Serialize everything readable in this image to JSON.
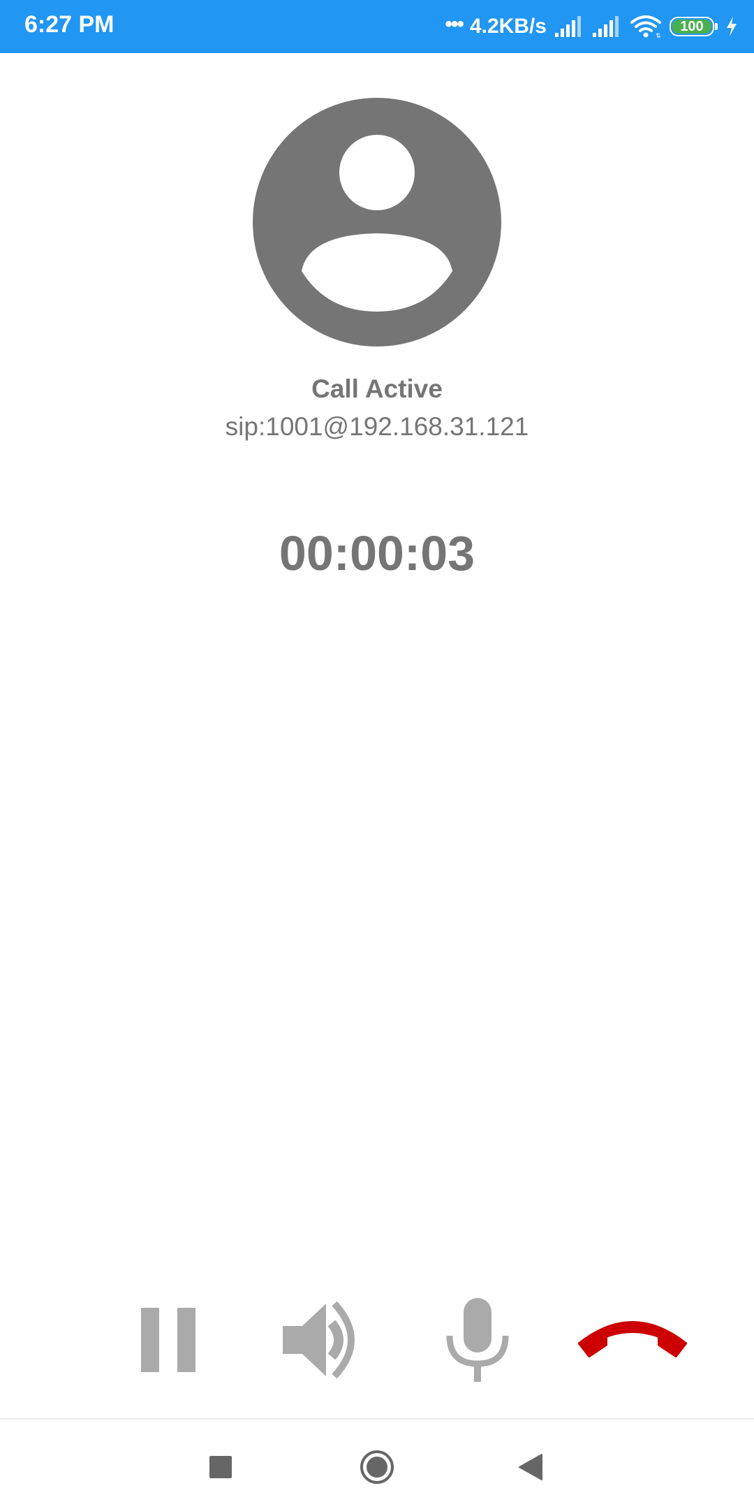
{
  "status_bar": {
    "time": "6:27 PM",
    "dots": "•••",
    "net_speed": "4.2KB/s",
    "battery_level": "100",
    "icons": [
      "signal-icon",
      "signal-icon",
      "wifi-icon",
      "battery-icon",
      "charging-icon"
    ],
    "background_color": "#2196f3",
    "battery_color": "#4caf50"
  },
  "call": {
    "avatar_icon": "person-avatar-icon",
    "state": "Call Active",
    "address": "sip:1001@192.168.31.121",
    "timer": "00:00:03",
    "text_color": "#757575"
  },
  "controls": {
    "items": [
      {
        "name": "hold-button",
        "icon": "pause-icon"
      },
      {
        "name": "speaker-button",
        "icon": "speaker-icon"
      },
      {
        "name": "mute-button",
        "icon": "microphone-icon"
      },
      {
        "name": "hangup-button",
        "icon": "end-call-icon"
      }
    ],
    "icon_color": "#aaaaaa",
    "hangup_color": "#cc0000"
  },
  "nav_bar": {
    "items": [
      {
        "name": "recents-button",
        "icon": "square-icon"
      },
      {
        "name": "home-button",
        "icon": "home-circle-icon"
      },
      {
        "name": "back-button",
        "icon": "back-triangle-icon"
      }
    ]
  }
}
